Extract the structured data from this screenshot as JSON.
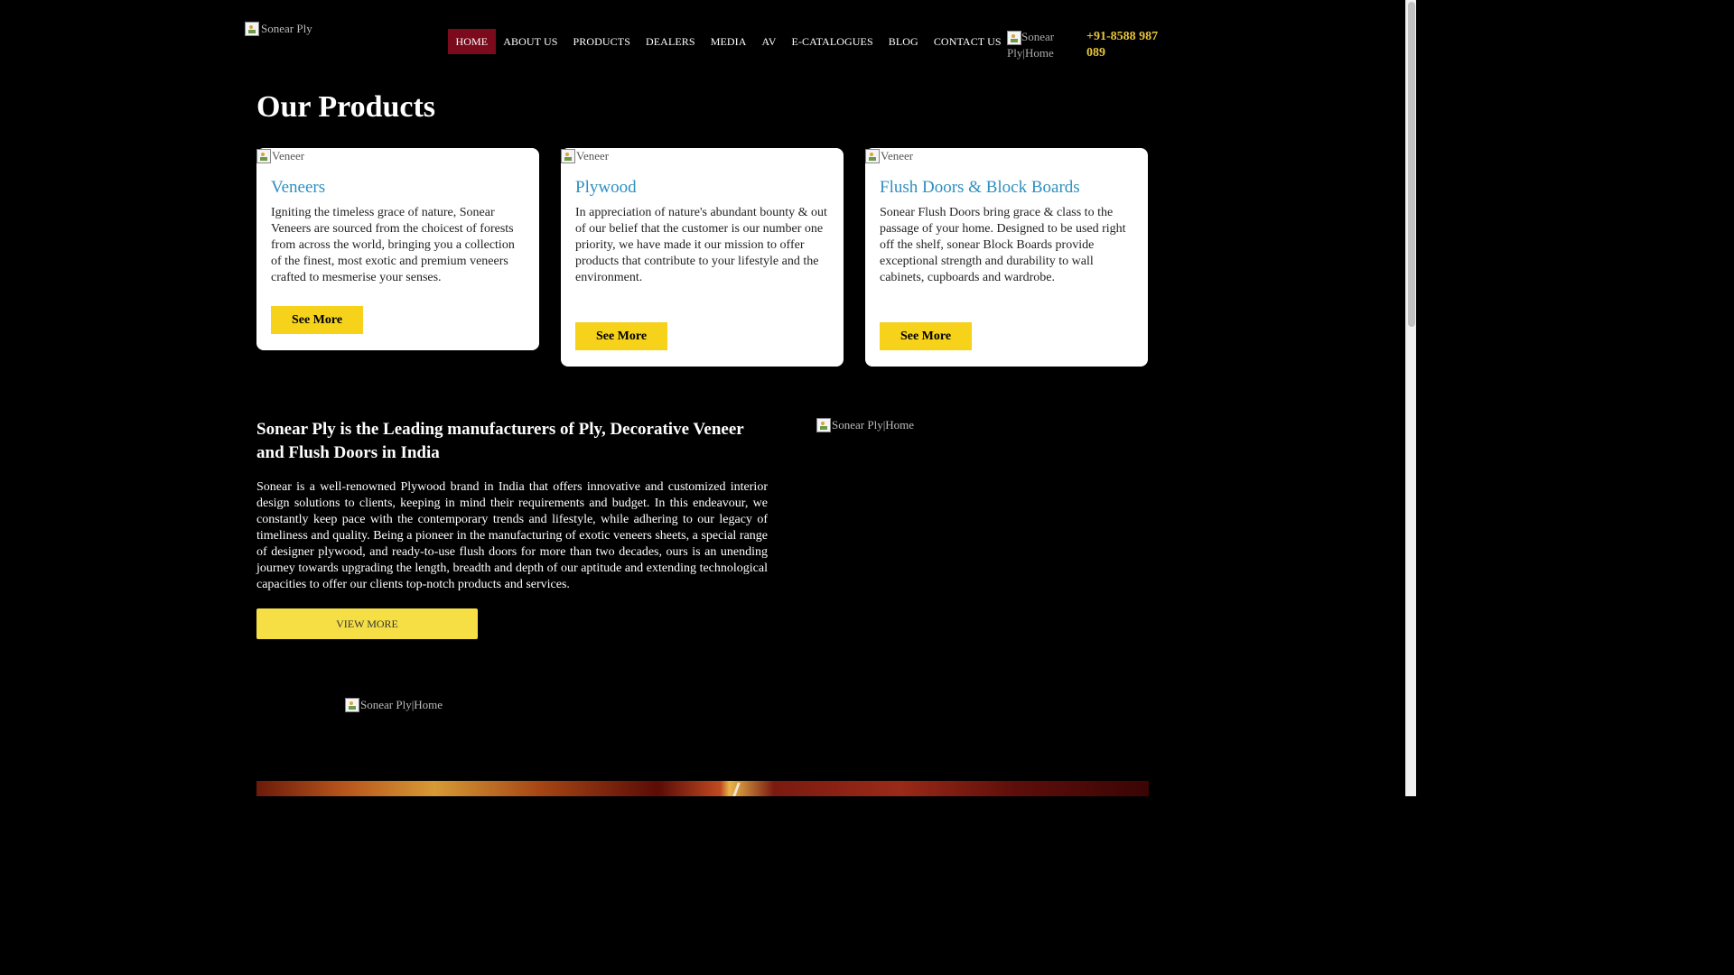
{
  "header": {
    "logo_alt": "Sonear Ply",
    "nav": [
      {
        "label": "HOME",
        "active": true
      },
      {
        "label": "ABOUT US"
      },
      {
        "label": "PRODUCTS"
      },
      {
        "label": "DEALERS"
      },
      {
        "label": "MEDIA"
      },
      {
        "label": "AV"
      },
      {
        "label": "E-CATALOGUES"
      },
      {
        "label": "BLOG"
      },
      {
        "label": "CONTACT US"
      }
    ],
    "header_img_alt": "Sonear Ply|Home",
    "phone": "+91-8588 987 089"
  },
  "products": {
    "title": "Our Products",
    "cards": [
      {
        "img_alt": "Veneer",
        "title": "Veneers",
        "text": "Igniting the timeless grace of nature, Sonear Veneers are sourced from the choicest of forests from across the world, bringing you a collection of the finest, most exotic and premium veneers crafted to mesmerise your senses.",
        "button": "See More"
      },
      {
        "img_alt": "Veneer",
        "title": "Plywood",
        "text": "In appreciation of nature's abundant bounty & out of our belief that the customer is our number one priority, we have made it our mission to offer products that contribute to your lifestyle and the environment.",
        "button": "See More"
      },
      {
        "img_alt": "Veneer",
        "title": "Flush Doors & Block Boards",
        "text": "Sonear Flush Doors bring grace & class to the passage of your home. Designed to be used right off the shelf, sonear Block Boards provide exceptional strength and durability to wall cabinets, cupboards and wardrobe.",
        "button": "See More"
      }
    ]
  },
  "about": {
    "title": "Sonear Ply is the Leading manufacturers of Ply, Decorative Veneer and Flush Doors in India",
    "text": "Sonear is a well-renowned Plywood brand in India that offers innovative and customized interior design solutions to clients, keeping in mind their requirements and budget. In this endeavour, we constantly keep pace with the contemporary trends and lifestyle, while adhering to our legacy of timeliness and quality. Being a pioneer in the manufacturing of exotic veneers sheets, a special range of designer plywood, and ready-to-use flush doors for more than two decades, ours is an unending journey towards upgrading the length, breadth and depth of our aptitude and extending technological capacities to offer our clients top-notch products and services.",
    "button": "VIEW MORE",
    "img_alt": "Sonear Ply|Home"
  },
  "bottom": {
    "img_alt": "Sonear Ply|Home"
  },
  "colors": {
    "background": "#000000",
    "nav_active": "#7a0a1c",
    "phone": "#e8c63a",
    "card_title": "#2f8fc0",
    "button": "#f6d21a"
  }
}
